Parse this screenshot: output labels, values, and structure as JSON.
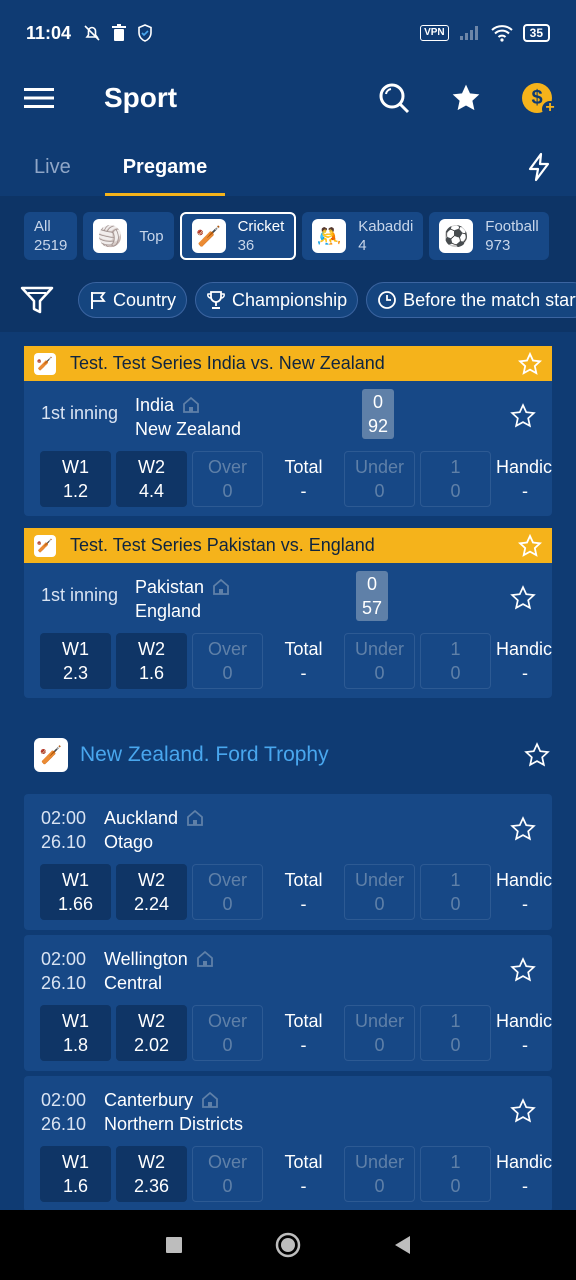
{
  "status_bar": {
    "time": "11:04",
    "vpn": "VPN",
    "battery": "35"
  },
  "app_bar": {
    "title": "Sport"
  },
  "tabs": [
    {
      "label": "Live"
    },
    {
      "label": "Pregame"
    }
  ],
  "sports": [
    {
      "label": "All",
      "count": "2519"
    },
    {
      "label": "Top",
      "count": ""
    },
    {
      "label": "Cricket",
      "count": "36"
    },
    {
      "label": "Kabaddi",
      "count": "4"
    },
    {
      "label": "Football",
      "count": "973"
    }
  ],
  "filters": [
    {
      "label": "Country"
    },
    {
      "label": "Championship"
    },
    {
      "label": "Before the match start"
    }
  ],
  "odds_labels": {
    "w1": "W1",
    "w2": "W2",
    "over": "Over",
    "total": "Total",
    "under": "Under",
    "one": "1",
    "handicap": "Handic"
  },
  "live_matches": [
    {
      "title": "Test. Test Series India vs. New Zealand",
      "period": "1st inning",
      "team1": "India",
      "team2": "New Zealand",
      "score1": "0",
      "score2": "92",
      "odds": {
        "w1": "1.2",
        "w2": "4.4",
        "over": "0",
        "total": "-",
        "under": "0",
        "one": "0",
        "handicap": "-"
      }
    },
    {
      "title": "Test. Test Series Pakistan vs. England",
      "period": "1st inning",
      "team1": "Pakistan",
      "team2": "England",
      "score1": "0",
      "score2": "57",
      "odds": {
        "w1": "2.3",
        "w2": "1.6",
        "over": "0",
        "total": "-",
        "under": "0",
        "one": "0",
        "handicap": "-"
      }
    }
  ],
  "league": {
    "title": "New Zealand. Ford Trophy"
  },
  "fixtures": [
    {
      "time": "02:00",
      "date": "26.10",
      "team1": "Auckland",
      "team2": "Otago",
      "odds": {
        "w1": "1.66",
        "w2": "2.24",
        "over": "0",
        "total": "-",
        "under": "0",
        "one": "0",
        "handicap": "-"
      }
    },
    {
      "time": "02:00",
      "date": "26.10",
      "team1": "Wellington",
      "team2": "Central",
      "odds": {
        "w1": "1.8",
        "w2": "2.02",
        "over": "0",
        "total": "-",
        "under": "0",
        "one": "0",
        "handicap": "-"
      }
    },
    {
      "time": "02:00",
      "date": "26.10",
      "team1": "Canterbury",
      "team2": "Northern Districts",
      "odds": {
        "w1": "1.6",
        "w2": "2.36",
        "over": "0",
        "total": "-",
        "under": "0",
        "one": "0",
        "handicap": "-"
      }
    }
  ],
  "colors": {
    "background": "#0f3b73",
    "accent": "#f5b31b",
    "card": "#174886",
    "league_title": "#49a7ee"
  }
}
